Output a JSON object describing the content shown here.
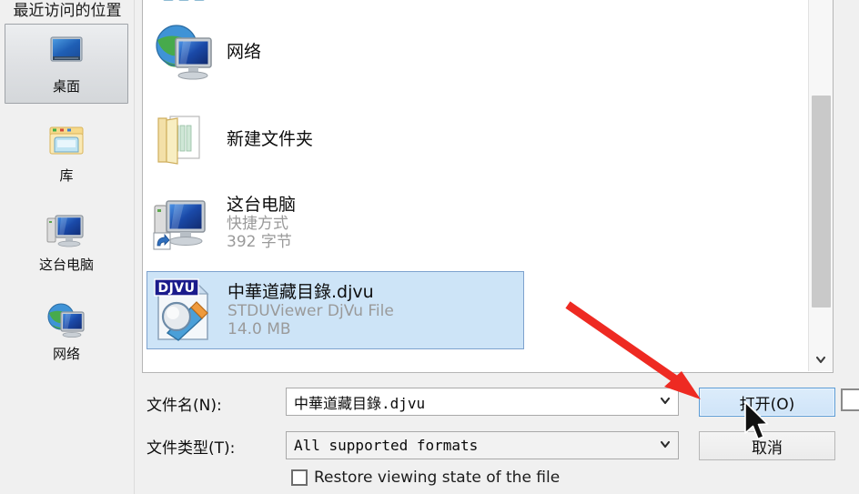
{
  "dialog": {
    "kind": "windows-file-open-dialog"
  },
  "places": {
    "scrolled_top_label": "最近访问的位置",
    "items": [
      {
        "label": "桌面",
        "icon": "desktop-icon",
        "selected": true
      },
      {
        "label": "库",
        "icon": "library-icon",
        "selected": false
      },
      {
        "label": "这台电脑",
        "icon": "computer-icon",
        "selected": false
      },
      {
        "label": "网络",
        "icon": "network-icon",
        "selected": false
      }
    ]
  },
  "filelist": {
    "items": [
      {
        "name": "网络",
        "type": "",
        "size": "",
        "icon": "network-icon",
        "selected": false
      },
      {
        "name": "新建文件夹",
        "type": "",
        "size": "",
        "icon": "folder-icon",
        "selected": false
      },
      {
        "name": "这台电脑",
        "type": "快捷方式",
        "size": "392 字节",
        "icon": "computer-shortcut-icon",
        "selected": false
      },
      {
        "name": "中華道藏目錄.djvu",
        "type": "STDUViewer DjVu File",
        "size": "14.0 MB",
        "icon": "djvu-file-icon",
        "selected": true
      }
    ],
    "scrollbar": {
      "down_arrow": "⌄"
    }
  },
  "form": {
    "filename_label": "文件名(N):",
    "filename_value": "中華道藏目錄.djvu",
    "filetype_label": "文件类型(T):",
    "filetype_value": "All supported formats",
    "dropdown_arrow": "⌄",
    "checkbox_label": "Restore viewing state of the file",
    "checkbox_checked": false
  },
  "buttons": {
    "open": "打开(O)",
    "cancel": "取消"
  },
  "annotation": {
    "arrow_color": "#ee2a22",
    "arrow_points_to": "open-button"
  },
  "colors": {
    "selection_fill": "#cde4f7",
    "selection_border": "#7da2ce",
    "default_button_border": "#5b9bd5",
    "pane_background": "#ffffff",
    "chrome_background": "#f0f0f0"
  }
}
